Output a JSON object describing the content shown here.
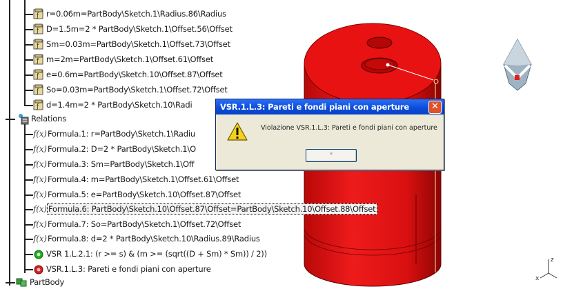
{
  "tree": {
    "parameters": [
      "r=0.06m=PartBody\\Sketch.1\\Radius.86\\Radius",
      "D=1.5m=2 * PartBody\\Sketch.1\\Offset.56\\Offset",
      "Sm=0.03m=PartBody\\Sketch.1\\Offset.73\\Offset",
      "m=2m=PartBody\\Sketch.1\\Offset.61\\Offset",
      "e=0.6m=PartBody\\Sketch.10\\Offset.87\\Offset",
      "So=0.03m=PartBody\\Sketch.1\\Offset.72\\Offset",
      "d=1.4m=2 * PartBody\\Sketch.10\\Radi"
    ],
    "relations_label": "Relations",
    "formulas": [
      "Formula.1: r=PartBody\\Sketch.1\\Radiu",
      "Formula.2: D=2 * PartBody\\Sketch.1\\O",
      "Formula.3: Sm=PartBody\\Sketch.1\\Off",
      "Formula.4: m=PartBody\\Sketch.1\\Offset.61\\Offset",
      "Formula.5: e=PartBody\\Sketch.10\\Offset.87\\Offset",
      "Formula.6: PartBody\\Sketch.10\\Offset.87\\Offset=PartBody\\Sketch.10\\Offset.88\\Offset",
      "Formula.7: So=PartBody\\Sketch.1\\Offset.72\\Offset",
      "Formula.8: d=2 * PartBody\\Sketch.10\\Radius.89\\Radius"
    ],
    "checks": [
      "VSR 1.L.2.1: (r >= s)  &  (m >= (sqrt((D + Sm) * Sm)) / 2))",
      "VSR.1.L.3: Pareti e fondi piani con aperture"
    ],
    "partbody_label": "PartBody"
  },
  "dialog": {
    "title": "VSR.1.L.3: Pareti e fondi piani con aperture",
    "message": "Violazione VSR.1.L.3: Pareti e fondi piani con aperture",
    "button_label": "*",
    "close_glyph": "✕"
  },
  "axes": {
    "z_label": "z",
    "x_label": "x"
  },
  "colors": {
    "cylinder": "#e30f0f",
    "cylinder_dark": "#9a0606",
    "dialog_title": "#0a4bd8",
    "check_ok": "#22aa22",
    "check_fail": "#d42020"
  }
}
